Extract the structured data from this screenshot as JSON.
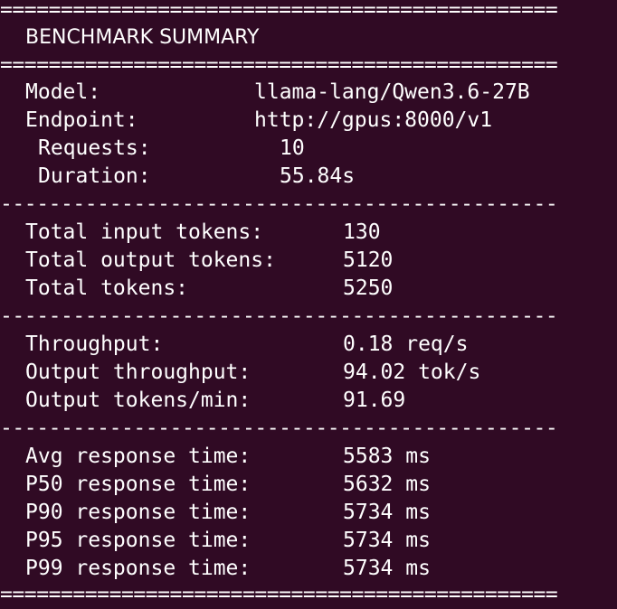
{
  "rules": {
    "double": "==============================================",
    "single": "----------------------------------------------"
  },
  "title": "BENCHMARK SUMMARY",
  "meta": {
    "model_label": "Model:",
    "model_value": "llama-lang/Qwen3.6-27B",
    "endpoint_label": "Endpoint:",
    "endpoint_value": "http://gpus:8000/v1",
    "requests_label": "Requests:",
    "requests_value": "10",
    "duration_label": "Duration:",
    "duration_value": "55.84s"
  },
  "tokens": {
    "input_label": "Total input tokens:",
    "input_value": "130",
    "output_label": "Total output tokens:",
    "output_value": "5120",
    "total_label": "Total tokens:",
    "total_value": "5250"
  },
  "throughput": {
    "throughput_label": "Throughput:",
    "throughput_value": "0.18 req/s",
    "output_throughput_label": "Output throughput:",
    "output_throughput_value": "94.02 tok/s",
    "tokens_per_min_label": "Output tokens/min:",
    "tokens_per_min_value": "91.69"
  },
  "latency": {
    "avg_label": "Avg response time:",
    "avg_value": "5583 ms",
    "p50_label": "P50 response time:",
    "p50_value": "5632 ms",
    "p90_label": "P90 response time:",
    "p90_value": "5734 ms",
    "p95_label": "P95 response time:",
    "p95_value": "5734 ms",
    "p99_label": "P99 response time:",
    "p99_value": "5734 ms"
  }
}
